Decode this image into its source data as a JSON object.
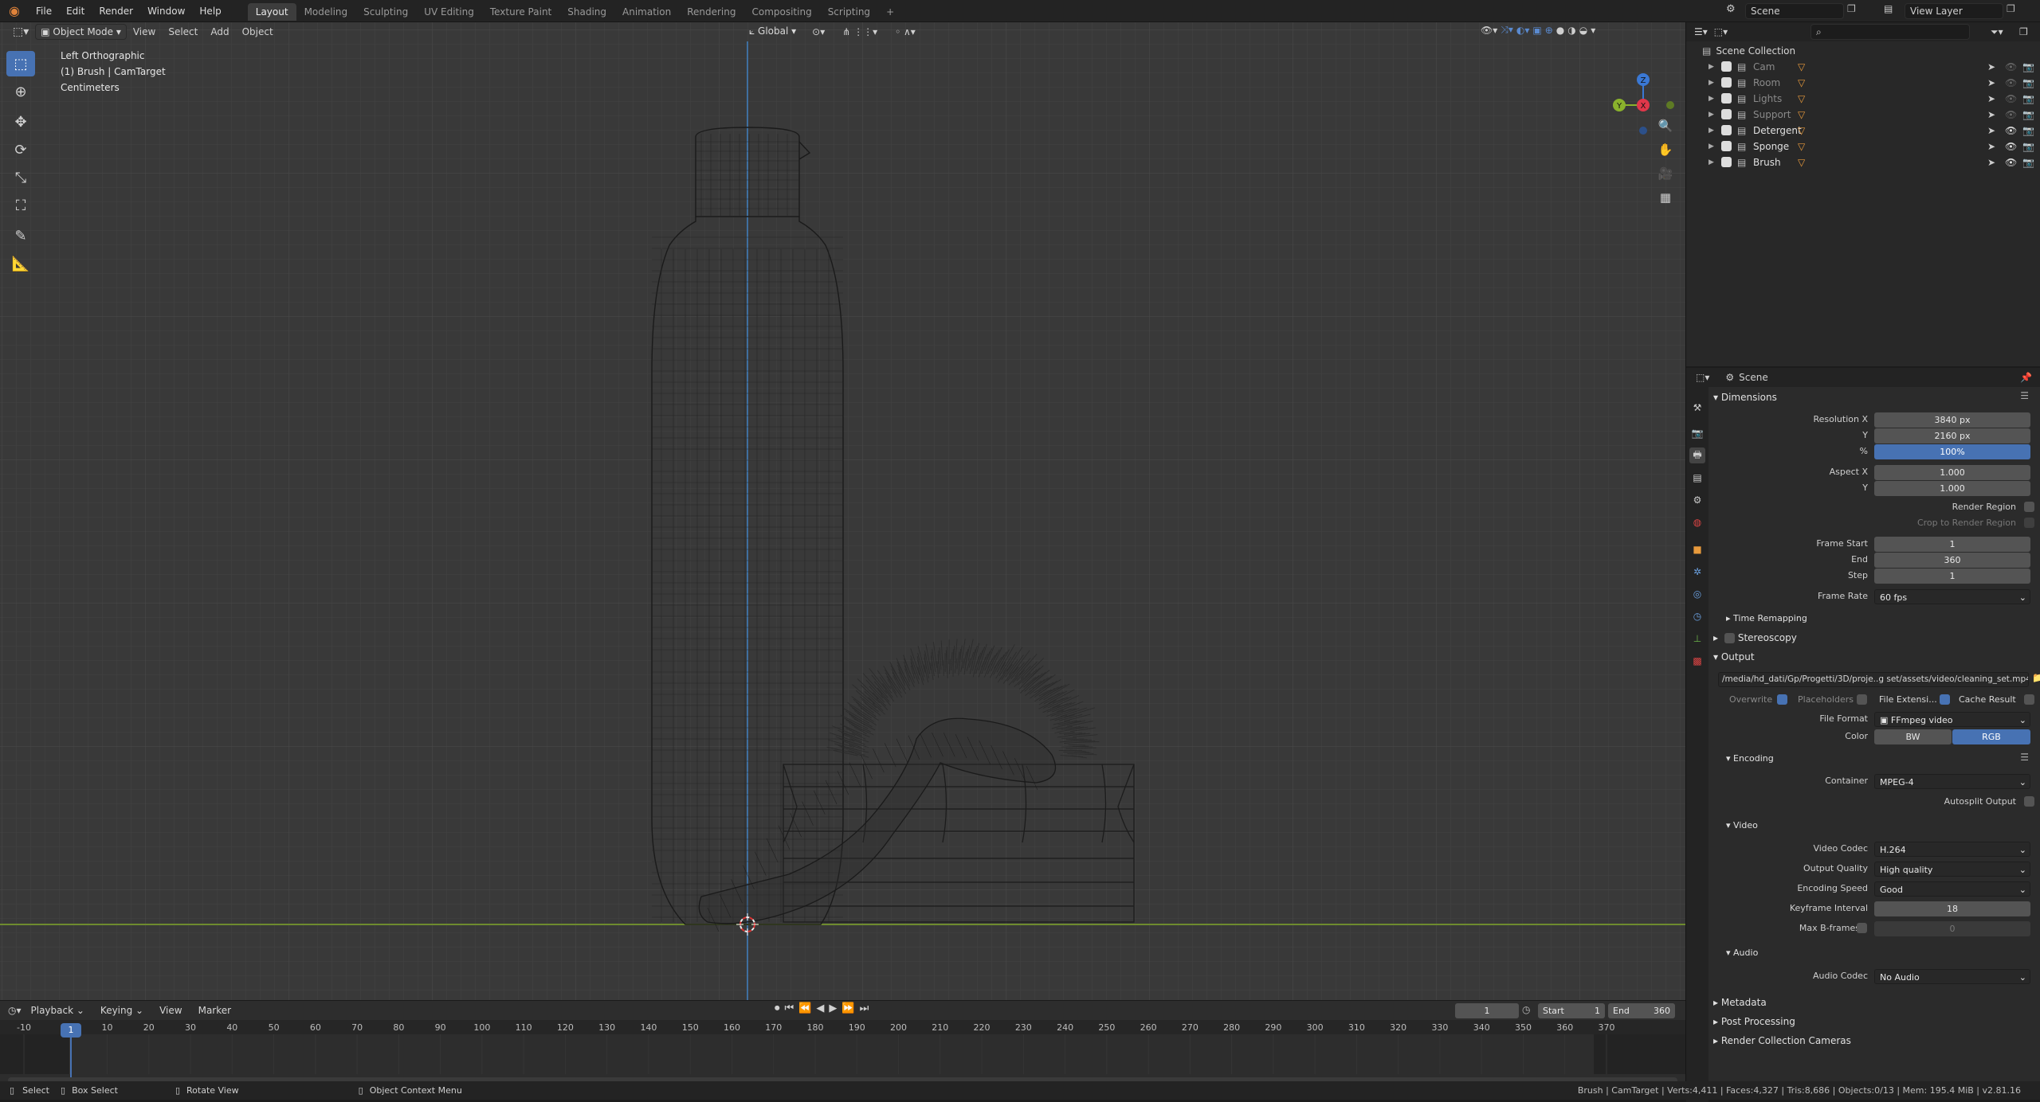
{
  "menus": [
    "File",
    "Edit",
    "Render",
    "Window",
    "Help"
  ],
  "workspaces": [
    "Layout",
    "Modeling",
    "Sculpting",
    "UV Editing",
    "Texture Paint",
    "Shading",
    "Animation",
    "Rendering",
    "Compositing",
    "Scripting"
  ],
  "add_workspace": "+",
  "scene_name": "Scene",
  "view_layer": "View Layer",
  "viewport": {
    "mode": "Object Mode",
    "menus": [
      "View",
      "Select",
      "Add",
      "Object"
    ],
    "orientation": "Global",
    "overlay_lines": [
      "Left Orthographic",
      "(1) Brush | CamTarget",
      "Centimeters"
    ],
    "gizmo_axes": {
      "z": "Z",
      "y": "Y",
      "x": "X"
    }
  },
  "outliner": {
    "title": "Scene Collection",
    "items": [
      {
        "name": "Cam",
        "dim": true
      },
      {
        "name": "Room",
        "dim": true
      },
      {
        "name": "Lights",
        "dim": true
      },
      {
        "name": "Support",
        "dim": true
      },
      {
        "name": "Detergent",
        "dim": false
      },
      {
        "name": "Sponge",
        "dim": false
      },
      {
        "name": "Brush",
        "dim": false
      }
    ]
  },
  "properties": {
    "context": "Scene",
    "dimensions": {
      "title": "Dimensions",
      "resolution_x_label": "Resolution X",
      "resolution_x": "3840 px",
      "resolution_y_label": "Y",
      "resolution_y": "2160 px",
      "percent_label": "%",
      "percent": "100%",
      "aspect_x_label": "Aspect X",
      "aspect_x": "1.000",
      "aspect_y_label": "Y",
      "aspect_y": "1.000",
      "render_region": "Render Region",
      "crop_region": "Crop to Render Region",
      "frame_start_label": "Frame Start",
      "frame_start": "1",
      "end_label": "End",
      "end": "360",
      "step_label": "Step",
      "step": "1",
      "frame_rate_label": "Frame Rate",
      "frame_rate": "60 fps"
    },
    "time_remapping": "Time Remapping",
    "stereoscopy": "Stereoscopy",
    "output": {
      "title": "Output",
      "path": "/media/hd_dati/Gp/Progetti/3D/proje..g set/assets/video/cleaning_set.mp4",
      "overwrite": "Overwrite",
      "placeholders": "Placeholders",
      "file_ext": "File Extensi...",
      "cache_result": "Cache Result",
      "file_format_label": "File Format",
      "file_format": "FFmpeg video",
      "color_label": "Color",
      "bw": "BW",
      "rgb": "RGB"
    },
    "encoding": {
      "title": "Encoding",
      "container_label": "Container",
      "container": "MPEG-4",
      "autosplit": "Autosplit Output"
    },
    "video": {
      "title": "Video",
      "codec_label": "Video Codec",
      "codec": "H.264",
      "quality_label": "Output Quality",
      "quality": "High quality",
      "speed_label": "Encoding Speed",
      "speed": "Good",
      "keyframe_label": "Keyframe Interval",
      "keyframe": "18",
      "bframes_label": "Max B-frames",
      "bframes": "0"
    },
    "audio": {
      "title": "Audio",
      "codec_label": "Audio Codec",
      "codec": "No Audio"
    },
    "metadata": "Metadata",
    "post_processing": "Post Processing",
    "render_cameras": "Render Collection Cameras"
  },
  "timeline": {
    "menus": [
      "Playback",
      "Keying",
      "View",
      "Marker"
    ],
    "current_frame": "1",
    "start_label": "Start",
    "start": "1",
    "end_label": "End",
    "end": "360",
    "ticks": [
      "-10",
      "1",
      "10",
      "20",
      "30",
      "40",
      "50",
      "60",
      "70",
      "80",
      "90",
      "100",
      "110",
      "120",
      "130",
      "140",
      "150",
      "160",
      "170",
      "180",
      "190",
      "200",
      "210",
      "220",
      "230",
      "240",
      "250",
      "260",
      "270",
      "280",
      "290",
      "300",
      "310",
      "320",
      "330",
      "340",
      "350",
      "360",
      "370"
    ]
  },
  "status": {
    "select": "Select",
    "box_select": "Box Select",
    "rotate_view": "Rotate View",
    "context_menu": "Object Context Menu",
    "stats": "Brush | CamTarget | Verts:4,411 | Faces:4,327 | Tris:8,686 | Objects:0/13 | Mem: 195.4 MiB | v2.81.16"
  }
}
